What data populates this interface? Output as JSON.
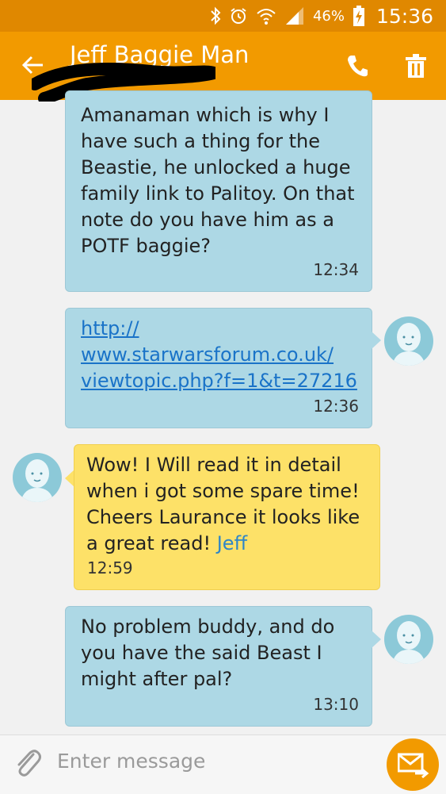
{
  "status_bar": {
    "battery_percent": "46%",
    "time": "15:36",
    "icons": [
      "bluetooth-icon",
      "alarm-icon",
      "wifi-icon",
      "signal-icon",
      "battery-charging-icon"
    ]
  },
  "header": {
    "title": "Jeff Baggie Man",
    "back_icon": "arrow-left-icon",
    "call_icon": "phone-icon",
    "delete_icon": "trash-icon"
  },
  "messages": [
    {
      "direction": "outgoing",
      "text": "Amanaman which is why I\nhave such a thing for the\nBeastie, he unlocked a huge\nfamily link to Palitoy. On that\nnote do you have him as a\nPOTF baggie?",
      "time": "12:34"
    },
    {
      "direction": "outgoing",
      "link": "http://\nwww.starwarsforum.co.uk/\nviewtopic.php?f=1&t=27216",
      "time": "12:36"
    },
    {
      "direction": "incoming",
      "text": "Wow! I Will read it in detail\nwhen i got some spare time!\nCheers Laurance it looks like\na great read!  ",
      "signature": "Jeff",
      "time": "12:59"
    },
    {
      "direction": "outgoing",
      "text": "No problem buddy, and do\nyou have the said Beast I\nmight after pal?",
      "time": "13:10"
    }
  ],
  "composer": {
    "placeholder": "Enter message",
    "attach_icon": "paperclip-icon",
    "send_icon": "send-icon"
  },
  "colors": {
    "accent": "#f29a00",
    "status_bar": "#e08800",
    "outgoing_bubble": "#add8e5",
    "incoming_bubble": "#fde168",
    "link": "#1a73c8",
    "avatar": "#8cc9d8"
  }
}
